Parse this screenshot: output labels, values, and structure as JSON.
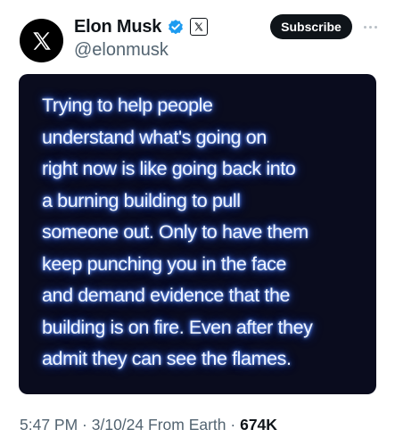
{
  "author": {
    "display_name": "Elon Musk",
    "handle": "@elonmusk",
    "avatar_icon": "x-logo-icon",
    "verified_icon": "verified-badge-icon",
    "affiliate_icon": "x-affiliate-badge-icon"
  },
  "actions": {
    "subscribe_label": "Subscribe",
    "more_icon": "more-options-icon"
  },
  "media": {
    "text_lines": [
      "Trying to help people",
      "understand what's going on",
      "right now is like going back into",
      "a burning building to pull",
      "someone out. Only to have them",
      "keep punching you in the face",
      "and demand evidence that the",
      "building is on fire. Even after they",
      "admit they can see the flames."
    ]
  },
  "meta": {
    "time": "5:47 PM",
    "separator": " · ",
    "date": "3/10/24",
    "source": " From Earth",
    "views": "674K"
  },
  "colors": {
    "text_primary": "#0f1419",
    "text_secondary": "#536471",
    "verified_blue": "#1d9bf0",
    "media_background": "#0a0c1e",
    "glow": "#3a6dff"
  }
}
